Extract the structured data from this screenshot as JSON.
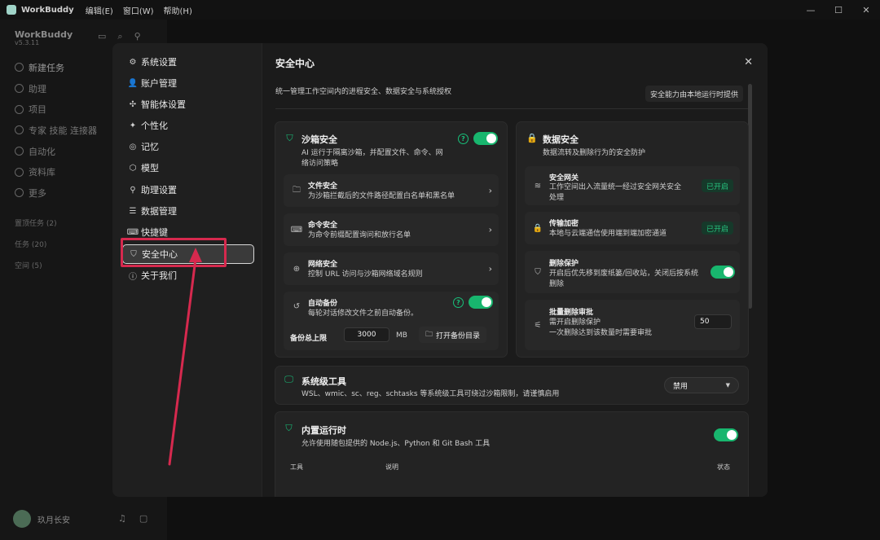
{
  "titlebar": {
    "app_name": "WorkBuddy",
    "menus": [
      "编辑(E)",
      "窗口(W)",
      "帮助(H)"
    ],
    "controls": [
      "—",
      "☐",
      "✕"
    ]
  },
  "background_sidebar": {
    "app": "WorkBuddy",
    "version": "v5.3.11",
    "nav": [
      "新建任务",
      "助理",
      "项目",
      "专家 技能 连接器",
      "自动化",
      "资料库",
      "更多"
    ],
    "groups": [
      "置顶任务 (2)",
      "任务 (20)",
      "空间 (5)"
    ],
    "user": "玖月长安"
  },
  "settings_nav": {
    "items": [
      {
        "label": "系统设置",
        "icon": "⚙"
      },
      {
        "label": "账户管理",
        "icon": "👤"
      },
      {
        "label": "智能体设置",
        "icon": "✣"
      },
      {
        "label": "个性化",
        "icon": "✦"
      },
      {
        "label": "记忆",
        "icon": "◎"
      },
      {
        "label": "模型",
        "icon": "⬡"
      },
      {
        "label": "助理设置",
        "icon": "⚲"
      },
      {
        "label": "数据管理",
        "icon": "☰"
      },
      {
        "label": "快捷键",
        "icon": "⌨"
      },
      {
        "label": "安全中心",
        "icon": "⛉"
      },
      {
        "label": "关于我们",
        "icon": "ⓘ"
      }
    ]
  },
  "content": {
    "title": "安全中心",
    "description": "统一管理工作空间内的进程安全、数据安全与系统授权",
    "provider": "安全能力由本地运行时提供",
    "sandbox": {
      "title": "沙箱安全",
      "subtitle_line1": "AI 运行于隔离沙箱，并配置文件、命令、网",
      "subtitle_line2": "络访问策略",
      "rows": [
        {
          "title": "文件安全",
          "sub": "为沙箱拦截后的文件路径配置白名单和黑名单",
          "icon": "🗀"
        },
        {
          "title": "命令安全",
          "sub": "为命令前缀配置询问和放行名单",
          "icon": "⌨"
        },
        {
          "title": "网络安全",
          "sub": "控制 URL 访问与沙箱网络域名规则",
          "icon": "⊕"
        }
      ],
      "backup": {
        "title": "自动备份",
        "sub": "每轮对话修改文件之前自动备份。",
        "limit_label": "备份总上限",
        "limit_value": "3000",
        "unit": "MB",
        "open_button": "打开备份目录"
      }
    },
    "data_security": {
      "title": "数据安全",
      "subtitle": "数据流转及删除行为的安全防护",
      "rows": [
        {
          "title": "安全网关",
          "sub1": "工作空间出入流量统一经过安全网关安全",
          "sub2": "处理",
          "status": "已开启",
          "icon": "≋"
        },
        {
          "title": "传输加密",
          "sub1": "本地与云端通信使用端到端加密通道",
          "sub2": "",
          "status": "已开启",
          "icon": "🔒"
        },
        {
          "title": "删除保护",
          "sub1": "开启后优先移到废纸篓/回收站，关闭后按系统",
          "sub2": "删除",
          "icon": "⛉"
        },
        {
          "title": "批量删除审批",
          "sub1": "需开启删除保护",
          "sub2": "一次删除达到该数量时需要审批",
          "value": "50",
          "icon": "⚟"
        }
      ]
    },
    "system_tools": {
      "title": "系统级工具",
      "subtitle": "WSL、wmic、sc、reg、schtasks 等系统级工具可绕过沙箱限制，请谨慎启用",
      "select_value": "禁用"
    },
    "runtime": {
      "title": "内置运行时",
      "subtitle": "允许使用随包提供的 Node.js、Python 和 Git Bash 工具",
      "columns": [
        "工具",
        "说明",
        "状态"
      ]
    }
  },
  "icons": {
    "shield": "⛉",
    "lock": "🔒",
    "monitor": "🖵",
    "help": "?",
    "close": "✕",
    "chevron": "›",
    "folder": "🗀",
    "history": "↺"
  },
  "colors": {
    "accent": "#18b66e",
    "annotation": "#d6294e"
  }
}
